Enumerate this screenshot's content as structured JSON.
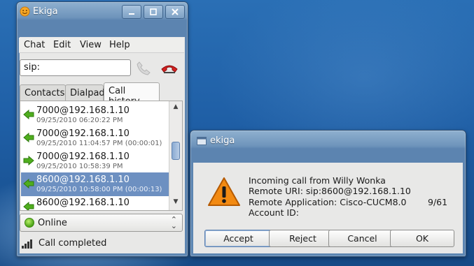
{
  "main_window": {
    "title": "Ekiga",
    "menu": [
      "Chat",
      "Edit",
      "View",
      "Help"
    ],
    "sip_input_value": "sip:",
    "tabs": [
      "Contacts",
      "Dialpad",
      "Call history"
    ],
    "active_tab": "Call history",
    "call_history": [
      {
        "uri": "7000@192.168.1.10",
        "detail": "09/25/2010 06:20:22 PM",
        "direction": "incoming"
      },
      {
        "uri": "7000@192.168.1.10",
        "detail": "09/25/2010 11:04:57 PM (00:00:01)",
        "direction": "incoming"
      },
      {
        "uri": "7000@192.168.1.10",
        "detail": "09/25/2010 10:58:39 PM",
        "direction": "outgoing"
      },
      {
        "uri": "8600@192.168.1.10",
        "detail": "09/25/2010 10:58:00 PM (00:00:13)",
        "direction": "incoming",
        "selected": true
      },
      {
        "uri": "8600@192.168.1.10",
        "detail": "",
        "direction": "incoming"
      }
    ],
    "presence_status": "Online",
    "status_text": "Call completed"
  },
  "dialog": {
    "title": "ekiga",
    "message_lines": [
      "Incoming call from Willy Wonka",
      "Remote URI: sip:8600@192.168.1.10",
      "Remote Application: Cisco-CUCM8.0",
      "Account ID:"
    ],
    "counter": "9/61",
    "buttons": [
      "Accept",
      "Reject",
      "Cancel",
      "OK"
    ]
  },
  "colors": {
    "selection": "#6d90c1",
    "arrow_green": "#4fae1e",
    "hangup_red": "#d42020",
    "warning_orange": "#f28a12"
  },
  "icons": [
    "smiley-icon",
    "phone-call-icon",
    "hangup-icon",
    "arrow-left-icon",
    "arrow-right-icon",
    "signal-icon",
    "warning-icon"
  ]
}
